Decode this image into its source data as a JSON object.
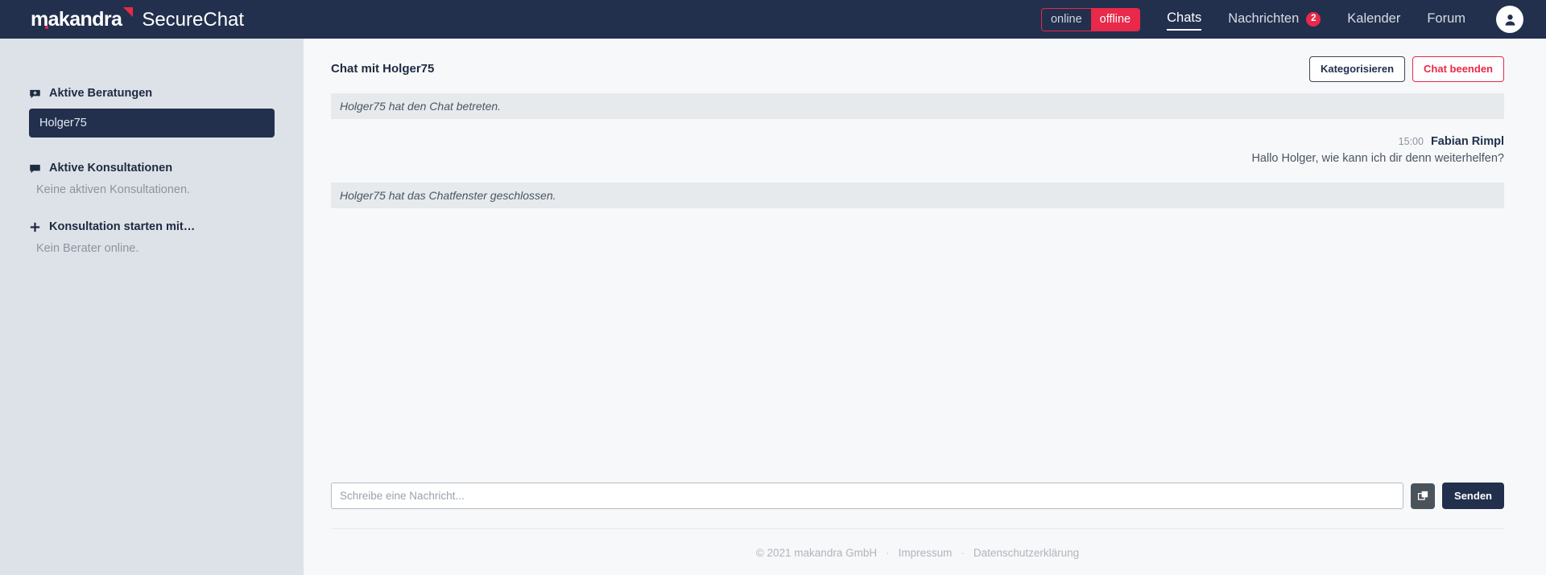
{
  "brand": {
    "logo_text": "makandra",
    "product_name": "SecureChat"
  },
  "header": {
    "status_toggle": {
      "online_label": "online",
      "offline_label": "offline",
      "selected": "offline"
    },
    "nav": [
      {
        "label": "Chats",
        "active": true
      },
      {
        "label": "Nachrichten",
        "badge": "2",
        "active": false
      },
      {
        "label": "Kalender",
        "active": false
      },
      {
        "label": "Forum",
        "active": false
      }
    ],
    "avatar_icon": "user-icon",
    "colors": {
      "bar_background": "#22304e",
      "accent_red": "#e8294a"
    }
  },
  "sidebar": {
    "groups": [
      {
        "icon": "chat-bubble-plus-icon",
        "title": "Aktive Beratungen",
        "items": [
          {
            "label": "Holger75",
            "selected": true
          }
        ],
        "empty_text": null
      },
      {
        "icon": "chat-bubble-icon",
        "title": "Aktive Konsultationen",
        "items": [],
        "empty_text": "Keine aktiven Konsultationen."
      },
      {
        "icon": "plus-icon",
        "title": "Konsultation starten mit…",
        "items": [],
        "empty_text": "Kein Berater online."
      }
    ]
  },
  "chat": {
    "title": "Chat mit Holger75",
    "actions": {
      "categorize_label": "Kategorisieren",
      "end_chat_label": "Chat beenden"
    },
    "messages": [
      {
        "type": "system",
        "text": "Holger75 hat den Chat betreten."
      },
      {
        "type": "user",
        "time": "15:00",
        "author": "Fabian Rimpl",
        "text": "Hallo Holger, wie kann ich dir denn weiterhelfen?"
      },
      {
        "type": "system",
        "text": "Holger75 hat das Chatfenster geschlossen."
      }
    ]
  },
  "composer": {
    "placeholder": "Schreibe eine Nachricht...",
    "value": "",
    "snippet_icon": "copy-icon",
    "send_label": "Senden"
  },
  "footer": {
    "copyright": "© 2021 makandra GmbH",
    "sep1": "·",
    "imprint_label": "Impressum",
    "sep2": "·",
    "privacy_label": "Datenschutzerklärung"
  }
}
